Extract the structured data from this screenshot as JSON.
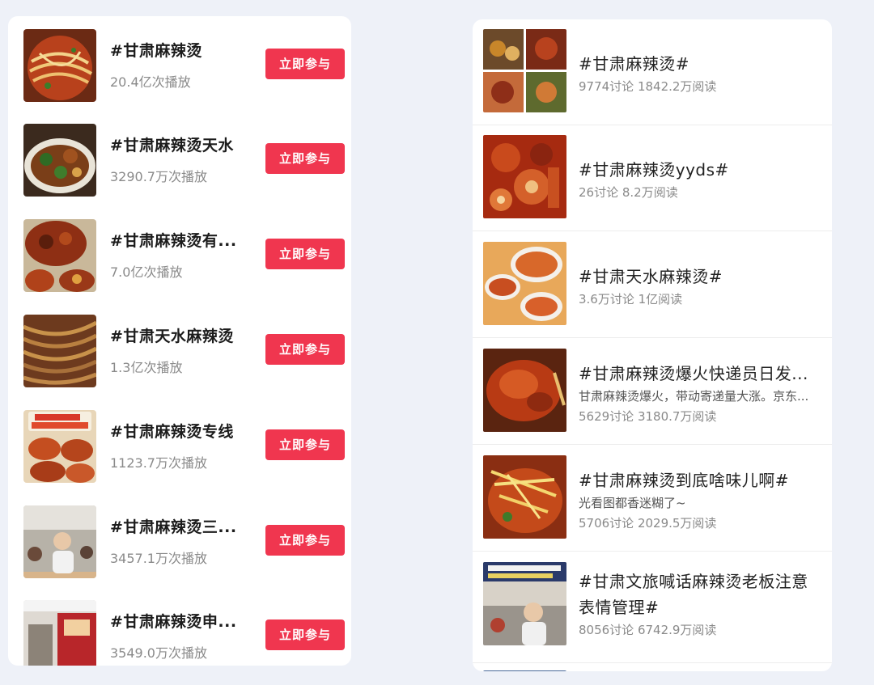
{
  "left_list": {
    "button_label": "立即参与",
    "items": [
      {
        "title": "#甘肃麻辣烫",
        "plays": "20.4亿次播放"
      },
      {
        "title": "#甘肃麻辣烫天水",
        "plays": "3290.7万次播放"
      },
      {
        "title": "#甘肃麻辣烫有...",
        "plays": "7.0亿次播放"
      },
      {
        "title": "#甘肃天水麻辣烫",
        "plays": "1.3亿次播放"
      },
      {
        "title": "#甘肃麻辣烫专线",
        "plays": "1123.7万次播放"
      },
      {
        "title": "#甘肃麻辣烫三...",
        "plays": "3457.1万次播放"
      },
      {
        "title": "#甘肃麻辣烫申...",
        "plays": "3549.0万次播放"
      }
    ]
  },
  "right_list": {
    "items": [
      {
        "title": "#甘肃麻辣烫#",
        "desc": "",
        "stats": "9774讨论 1842.2万阅读"
      },
      {
        "title": "#甘肃麻辣烫yyds#",
        "desc": "",
        "stats": "26讨论 8.2万阅读"
      },
      {
        "title": "#甘肃天水麻辣烫#",
        "desc": "",
        "stats": "3.6万讨论 1亿阅读"
      },
      {
        "title": "#甘肃麻辣烫爆火快递员日发...",
        "desc": "甘肃麻辣烫爆火，带动寄递量大涨。京东...",
        "stats": "5629讨论 3180.7万阅读"
      },
      {
        "title": "#甘肃麻辣烫到底啥味儿啊#",
        "desc": "光看图都香迷糊了~",
        "stats": "5706讨论 2029.5万阅读"
      },
      {
        "title": "#甘肃文旅喊话麻辣烫老板注意表情管理#",
        "desc": "",
        "stats": "8056讨论 6742.9万阅读"
      }
    ]
  }
}
